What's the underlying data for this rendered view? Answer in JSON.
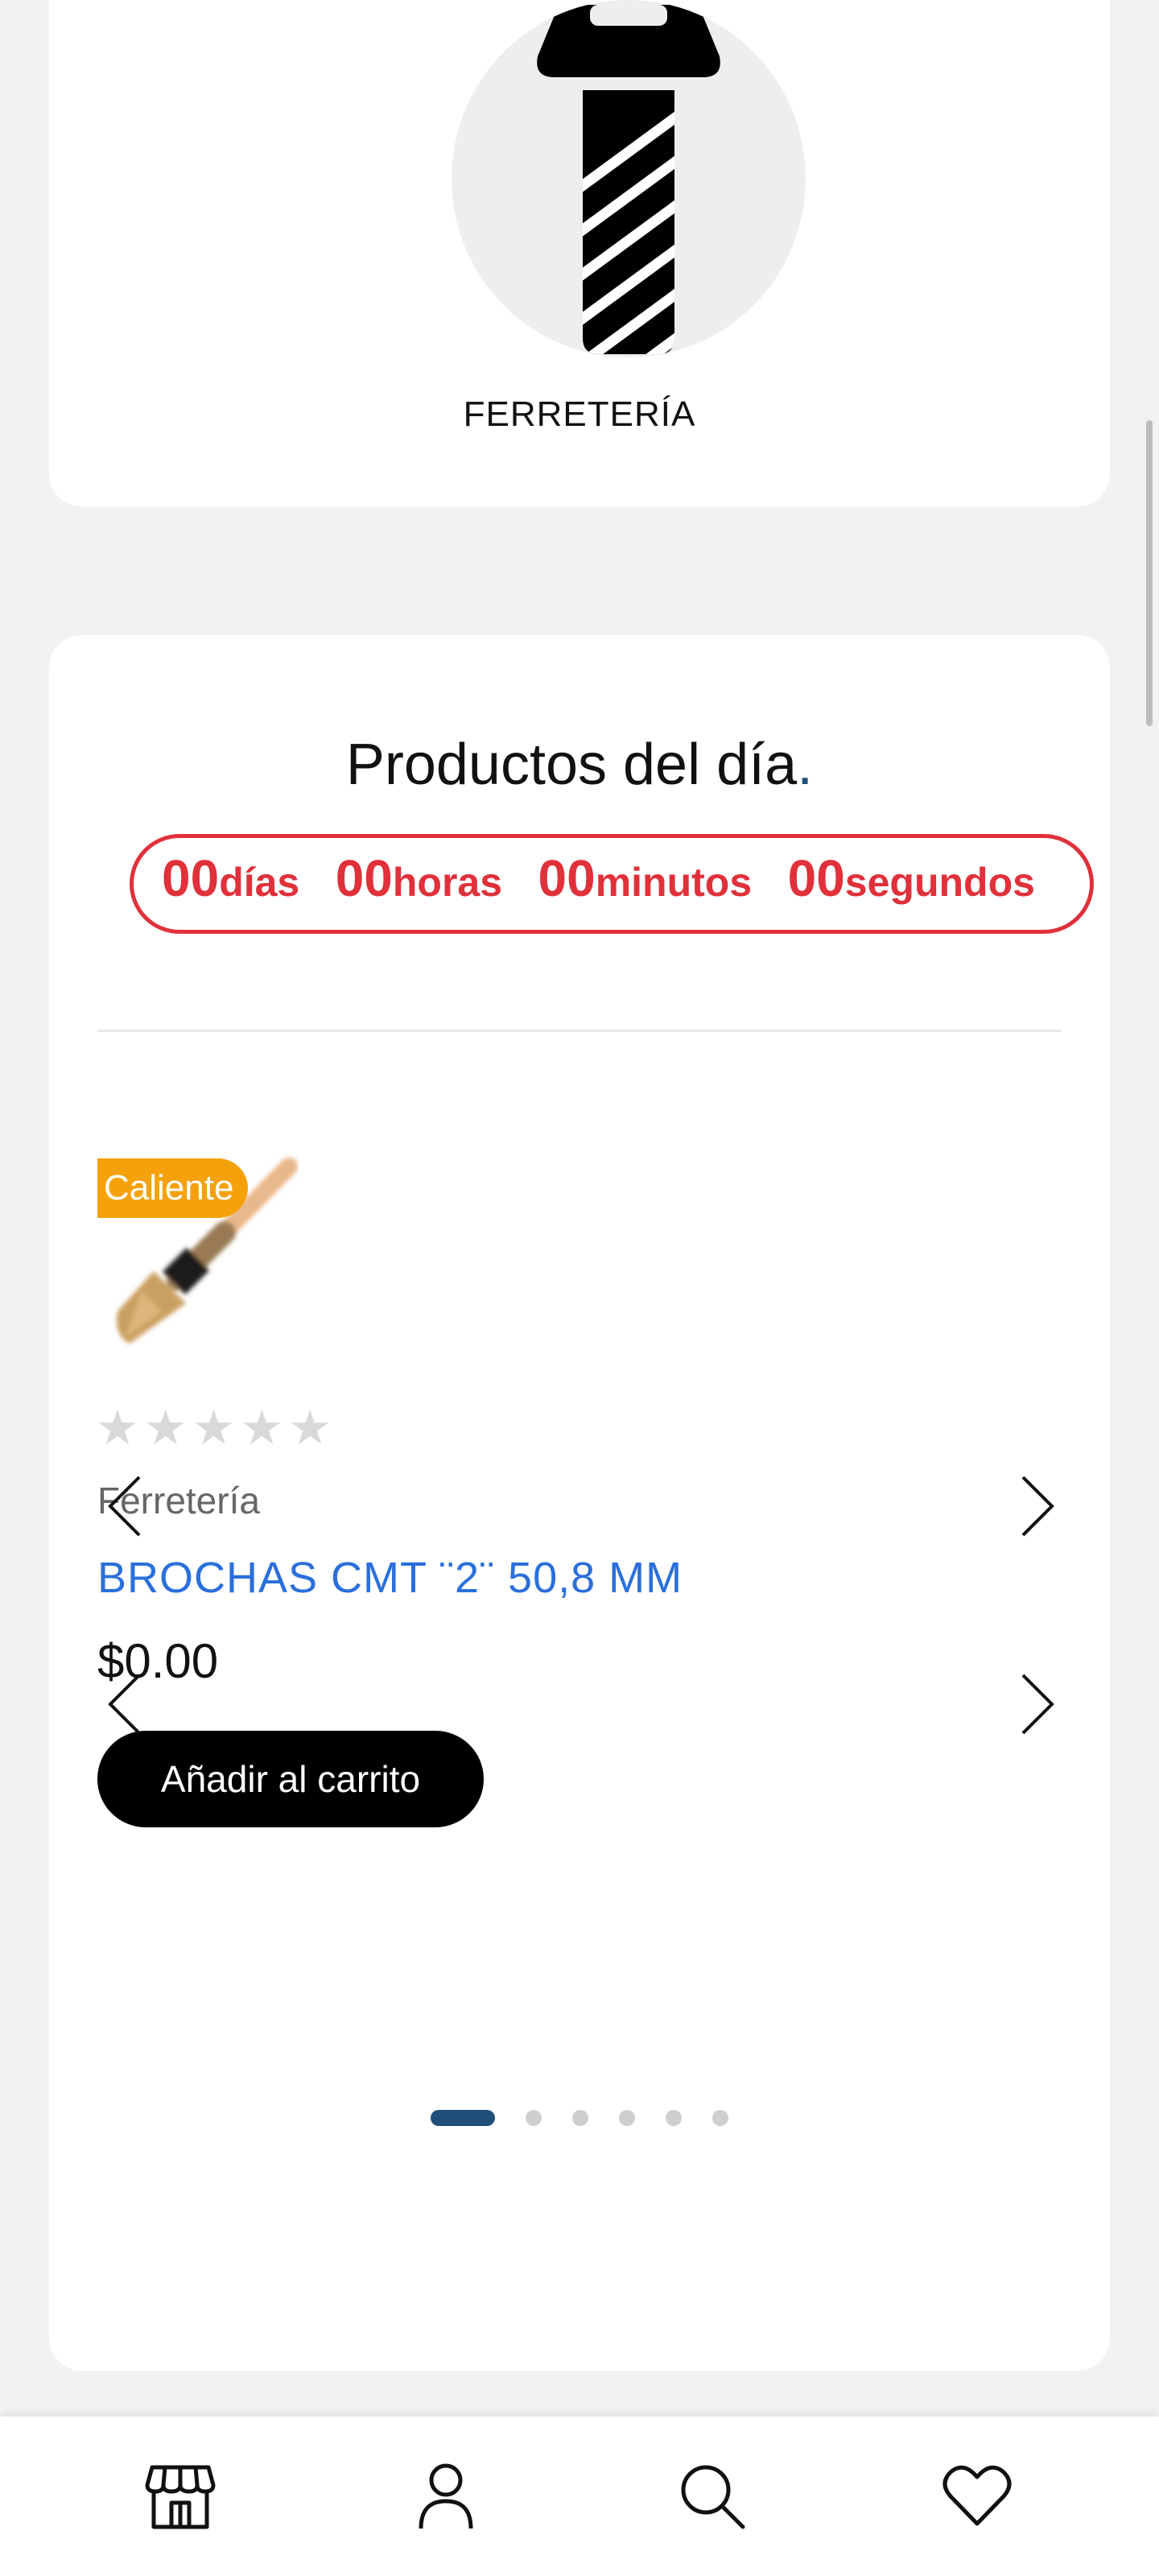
{
  "category": {
    "label": "FERRETERÍA",
    "icon": "screw-icon"
  },
  "deals": {
    "title": "Productos del día",
    "title_dot": ".",
    "countdown": [
      {
        "value": "00",
        "unit": "días"
      },
      {
        "value": "00",
        "unit": "horas"
      },
      {
        "value": "00",
        "unit": "minutos"
      },
      {
        "value": "00",
        "unit": "segundos"
      }
    ],
    "accent_color": "#e0313b"
  },
  "product": {
    "badge": "Caliente",
    "rating": 0,
    "rating_max": 5,
    "category": "Ferretería",
    "name": "BROCHAS CMT ¨2¨ 50,8 MM",
    "price": "$0.00",
    "add_to_cart": "Añadir al carrito",
    "image_icon": "paintbrush-icon"
  },
  "carousel": {
    "total_pages": 6,
    "active_index": 0
  },
  "bottom_nav": [
    {
      "icon": "store-icon"
    },
    {
      "icon": "user-icon"
    },
    {
      "icon": "search-icon"
    },
    {
      "icon": "heart-icon"
    }
  ]
}
